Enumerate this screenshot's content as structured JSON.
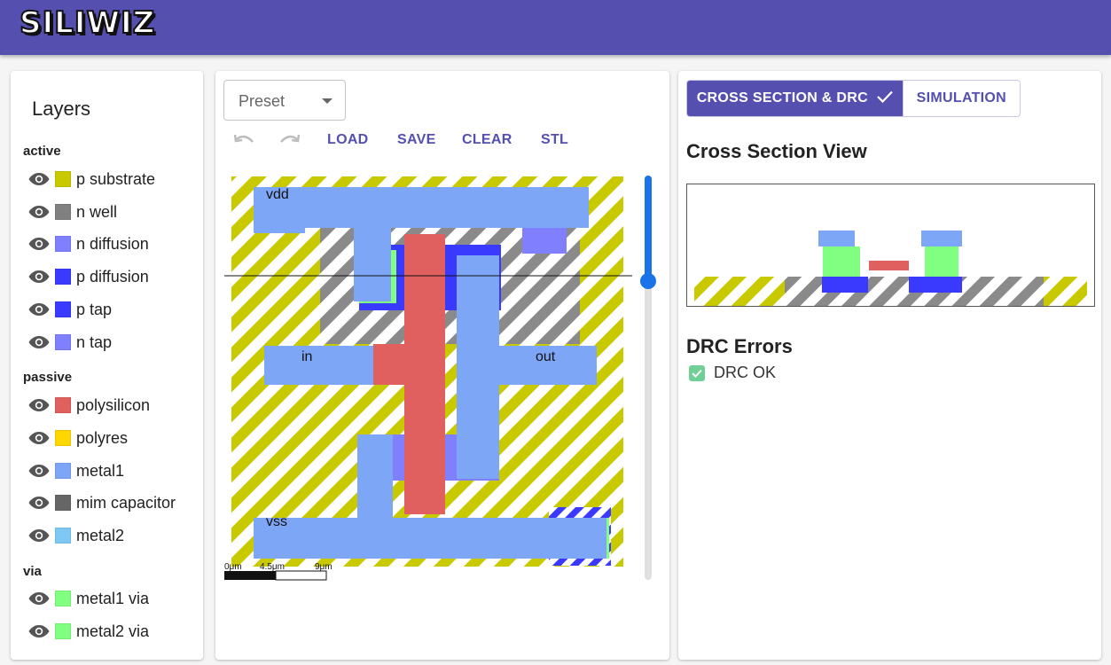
{
  "app": {
    "logo": "SILIWIZ"
  },
  "layers": {
    "title": "Layers",
    "groups": [
      {
        "name": "active",
        "items": [
          {
            "label": "p substrate",
            "color": "#c9c900"
          },
          {
            "label": "n well",
            "color": "#808080"
          },
          {
            "label": "n diffusion",
            "color": "#8080ff"
          },
          {
            "label": "p diffusion",
            "color": "#3a3aff"
          },
          {
            "label": "p tap",
            "color": "#3a3aff"
          },
          {
            "label": "n tap",
            "color": "#8080ff"
          }
        ]
      },
      {
        "name": "passive",
        "items": [
          {
            "label": "polysilicon",
            "color": "#e06060"
          },
          {
            "label": "polyres",
            "color": "#ffd700"
          },
          {
            "label": "metal1",
            "color": "#7ea6f7"
          },
          {
            "label": "mim capacitor",
            "color": "#666666"
          },
          {
            "label": "metal2",
            "color": "#7fc8f5"
          }
        ]
      },
      {
        "name": "via",
        "items": [
          {
            "label": "metal1 via",
            "color": "#80ff80"
          },
          {
            "label": "metal2 via",
            "color": "#80ff80"
          }
        ]
      }
    ]
  },
  "editor": {
    "preset_label": "Preset",
    "toolbar": {
      "load": "LOAD",
      "save": "SAVE",
      "clear": "CLEAR",
      "stl": "STL"
    },
    "labels": {
      "vdd": "vdd",
      "in": "in",
      "out": "out",
      "vss": "vss"
    },
    "scale": {
      "t0": "0μm",
      "t1": "4.5μm",
      "t2": "9μm"
    },
    "slider_level": 0.26
  },
  "right": {
    "tabs": {
      "cross_section": "CROSS SECTION & DRC",
      "simulation": "SIMULATION"
    },
    "cross_section_title": "Cross Section View",
    "drc_title": "DRC Errors",
    "drc_status": "DRC OK"
  }
}
